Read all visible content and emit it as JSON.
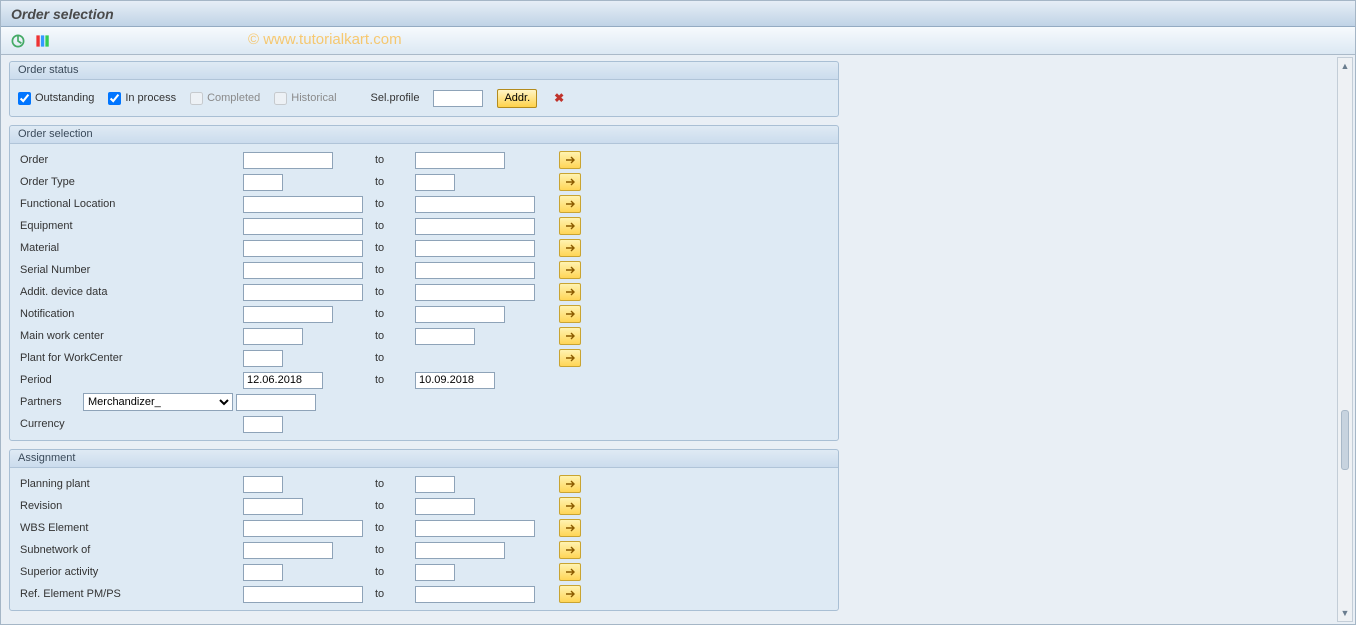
{
  "window": {
    "title": "Order selection"
  },
  "watermark": "© www.tutorialkart.com",
  "status_group": {
    "legend": "Order status",
    "outstanding_label": "Outstanding",
    "outstanding_checked": true,
    "inprocess_label": "In process",
    "inprocess_checked": true,
    "completed_label": "Completed",
    "completed_checked": false,
    "historical_label": "Historical",
    "historical_checked": false,
    "sel_profile_label": "Sel.profile",
    "sel_profile_value": "",
    "addr_button": "Addr.",
    "delete_tooltip": "Delete"
  },
  "selection_group": {
    "legend": "Order selection",
    "to_label": "to",
    "rows": [
      {
        "label": "Order",
        "from": "",
        "to": "",
        "from_w": 90,
        "to_w": 90,
        "multi": true
      },
      {
        "label": "Order Type",
        "from": "",
        "to": "",
        "from_w": 40,
        "to_w": 40,
        "multi": true
      },
      {
        "label": "Functional Location",
        "from": "",
        "to": "",
        "from_w": 120,
        "to_w": 120,
        "multi": true
      },
      {
        "label": "Equipment",
        "from": "",
        "to": "",
        "from_w": 120,
        "to_w": 120,
        "multi": true
      },
      {
        "label": "Material",
        "from": "",
        "to": "",
        "from_w": 120,
        "to_w": 120,
        "multi": true
      },
      {
        "label": "Serial Number",
        "from": "",
        "to": "",
        "from_w": 120,
        "to_w": 120,
        "multi": true
      },
      {
        "label": "Addit. device data",
        "from": "",
        "to": "",
        "from_w": 120,
        "to_w": 120,
        "multi": true
      },
      {
        "label": "Notification",
        "from": "",
        "to": "",
        "from_w": 90,
        "to_w": 90,
        "multi": true
      },
      {
        "label": "Main work center",
        "from": "",
        "to": "",
        "from_w": 60,
        "to_w": 60,
        "multi": true
      },
      {
        "label": "Plant for WorkCenter",
        "from": "",
        "to": "",
        "from_w": 40,
        "to_w": 0,
        "multi": true
      },
      {
        "label": "Period",
        "from": "12.06.2018",
        "to": "10.09.2018",
        "from_w": 80,
        "to_w": 80,
        "multi": false
      }
    ],
    "partners": {
      "label": "Partners",
      "dropdown_value": "Merchandizer_",
      "input_value": ""
    },
    "currency": {
      "label": "Currency",
      "value": ""
    }
  },
  "assignment_group": {
    "legend": "Assignment",
    "to_label": "to",
    "rows": [
      {
        "label": "Planning plant",
        "from": "",
        "to": "",
        "from_w": 40,
        "to_w": 40,
        "multi": true
      },
      {
        "label": "Revision",
        "from": "",
        "to": "",
        "from_w": 60,
        "to_w": 60,
        "multi": true
      },
      {
        "label": "WBS Element",
        "from": "",
        "to": "",
        "from_w": 120,
        "to_w": 120,
        "multi": true
      },
      {
        "label": "Subnetwork of",
        "from": "",
        "to": "",
        "from_w": 90,
        "to_w": 90,
        "multi": true
      },
      {
        "label": "Superior activity",
        "from": "",
        "to": "",
        "from_w": 40,
        "to_w": 40,
        "multi": true
      },
      {
        "label": "Ref. Element PM/PS",
        "from": "",
        "to": "",
        "from_w": 120,
        "to_w": 120,
        "multi": true
      }
    ]
  }
}
